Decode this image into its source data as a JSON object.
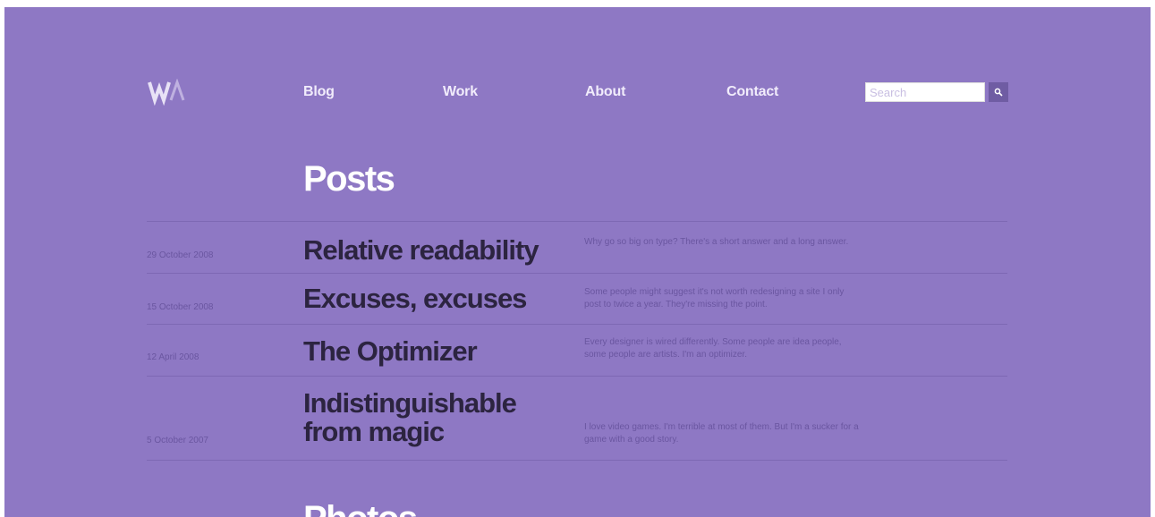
{
  "header": {
    "logo_text": "WA",
    "nav": [
      {
        "label": "Blog"
      },
      {
        "label": "Work"
      },
      {
        "label": "About"
      },
      {
        "label": "Contact"
      }
    ],
    "search": {
      "placeholder": "Search",
      "value": ""
    }
  },
  "posts_section": {
    "title": "Posts",
    "items": [
      {
        "date": "29 October 2008",
        "title": "Relative readability",
        "excerpt": "Why go so big on type? There's a short answer and a long answer."
      },
      {
        "date": "15 October 2008",
        "title": "Excuses, excuses",
        "excerpt": "Some people might suggest it's not worth redesigning a site I only post to twice a year. They're missing the point."
      },
      {
        "date": "12 April 2008",
        "title": "The Optimizer",
        "excerpt": "Every designer is wired differently. Some people are idea people, some people are artists. I'm an optimizer."
      },
      {
        "date": "5 October 2007",
        "title": "Indistinguishable from magic",
        "excerpt": "I love video games. I'm terrible at most of them. But I'm a sucker for a game with a good story."
      }
    ]
  },
  "photos_section": {
    "title": "Photos"
  },
  "colors": {
    "background": "#8e78c4",
    "title_text": "#2c2440",
    "muted_text": "#6a56a0"
  }
}
